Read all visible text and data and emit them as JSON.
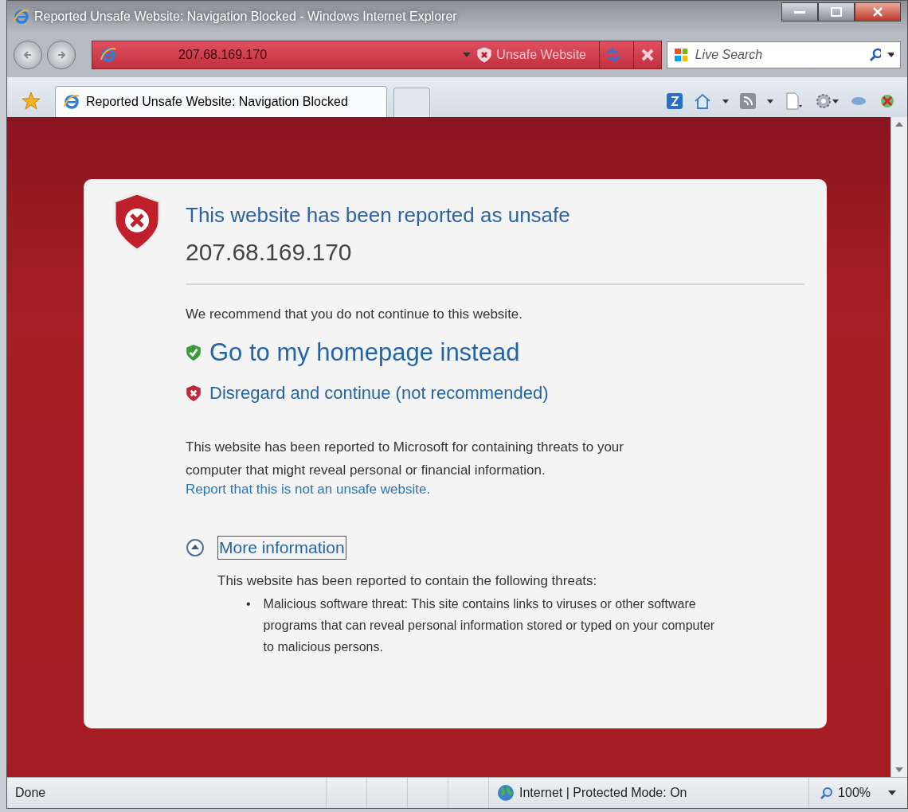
{
  "window": {
    "title": "Reported Unsafe Website: Navigation Blocked - Windows Internet Explorer"
  },
  "address_bar": {
    "url": "207.68.169.170",
    "status": "Unsafe Website"
  },
  "search": {
    "placeholder": "Live Search"
  },
  "tabs": [
    {
      "label": "Reported Unsafe Website: Navigation Blocked",
      "selected": true
    }
  ],
  "page": {
    "heading": "This website has been reported as unsafe",
    "address": "207.68.169.170",
    "recommendation": "We recommend that you do not continue to this website.",
    "links": [
      {
        "kind": "safe",
        "label": "Go to my homepage instead"
      },
      {
        "kind": "unsafe",
        "label": "Disregard and continue (not recommended)"
      }
    ],
    "explanation": "This website has been reported to Microsoft for containing threats to your computer that might reveal personal or financial information.",
    "report_link": "Report that this is not an unsafe website.",
    "more_info": {
      "label": "More information",
      "expanded": true,
      "intro": "This website has been reported to contain the following threats:",
      "threats": [
        {
          "marker": "•",
          "text": "Malicious software threat: This site contains links to viruses or other software programs that can reveal personal information stored or typed on your computer to malicious persons."
        }
      ]
    }
  },
  "status_bar": {
    "text": "Done",
    "zone": "Internet | Protected Mode: On",
    "zoom": "100%"
  }
}
